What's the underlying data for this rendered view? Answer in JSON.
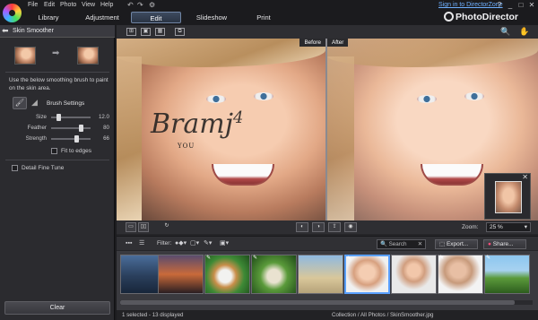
{
  "menu": [
    "File",
    "Edit",
    "Photo",
    "View",
    "Help"
  ],
  "mode_tabs": [
    "Library",
    "Adjustment",
    "Edit",
    "Slideshow",
    "Print"
  ],
  "top_link": "Sign in to DirectorZone",
  "brand": "PhotoDirector",
  "window_controls": {
    "help": "?",
    "minimize": "_",
    "maximize": "□",
    "close": "✕"
  },
  "panel": {
    "title": "Skin Smoother",
    "instructions": "Use the below smoothing brush to paint on the skin area.",
    "brush_settings": "Brush Settings",
    "sliders": [
      {
        "label": "Size",
        "value": "12.0",
        "fraction": 0.15
      },
      {
        "label": "Feather",
        "value": "80",
        "fraction": 0.8
      },
      {
        "label": "Strength",
        "value": "66",
        "fraction": 0.66
      }
    ],
    "fit_to_edges": "Fit to edges",
    "detail_fine_tune": "Detail Fine Tune",
    "clear": "Clear"
  },
  "view": {
    "before_label": "Before",
    "after_label": "After",
    "watermark": "Bramj",
    "watermark_num": "4",
    "watermark_sub": "YOU",
    "zoom_label": "Zoom:",
    "zoom_value": "25 %"
  },
  "filter": {
    "label": "Filter:",
    "search_placeholder": "Search",
    "export": "Export...",
    "share": "Share..."
  },
  "status": {
    "left": "1 selected - 13 displayed",
    "right": "Collection / All Photos / SkinSmoother.jpg"
  },
  "colors": {
    "accent": "#5aa0ff",
    "link": "#6fb0ff",
    "selected_tab_border": "#6f84a3"
  }
}
